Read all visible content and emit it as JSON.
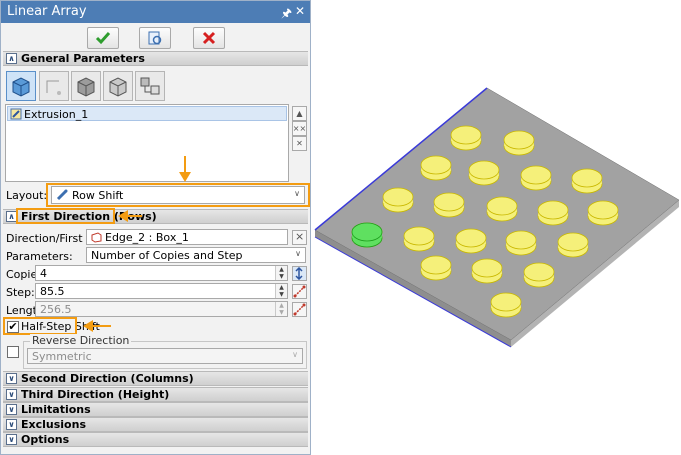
{
  "window": {
    "title": "Linear Array",
    "pin_icon": "pin-icon",
    "close_icon": "close-x-icon"
  },
  "actions": [
    {
      "name": "ok-button",
      "icon": "checkmark-icon",
      "color": "#2e9d2e"
    },
    {
      "name": "preview-button",
      "icon": "preview-icon",
      "color": "#3c6fb0"
    },
    {
      "name": "cancel-button",
      "icon": "cancel-x-icon",
      "color": "#d62020"
    }
  ],
  "general": {
    "header": "General Parameters",
    "list_items": [
      "Extrusion_1"
    ],
    "layout_label": "Layout:",
    "layout_value": "Row Shift"
  },
  "first": {
    "header": "First Direction (Rows)",
    "dir_label": "Direction/First point:",
    "dir_value": "Edge_2 : Box_1",
    "params_label": "Parameters:",
    "params_value": "Number of Copies and Step",
    "copies_label": "Copies:",
    "copies_value": "4",
    "step_label": "Step:",
    "step_value": "85.5",
    "length_label": "Length:",
    "length_value": "256.5",
    "half_step_label": "Half-Step Shift",
    "half_step_checked": true,
    "reverse_title": "Reverse Direction",
    "reverse_value": "Symmetric"
  },
  "collapsed_sections": [
    "Second Direction (Columns)",
    "Third Direction (Height)",
    "Limitations",
    "Exclusions",
    "Options"
  ],
  "accent": {
    "highlight": "#f39c12",
    "titlebar": "#4d7db5",
    "disc": "#f5f07a",
    "disc_selected": "#5fe060"
  }
}
